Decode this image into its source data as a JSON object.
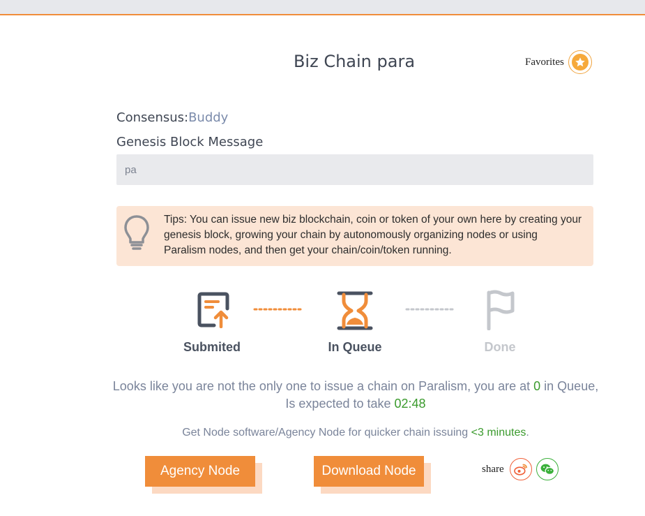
{
  "header": {
    "title": "Biz Chain para"
  },
  "favorites": {
    "label": "Favorites",
    "icon": "star-icon"
  },
  "consensus": {
    "label": "Consensus:",
    "value": "Buddy"
  },
  "genesis": {
    "label": "Genesis Block Message",
    "value": "pa"
  },
  "tips": {
    "icon": "lightbulb-icon",
    "text": "Tips: You can issue new biz blockchain, coin or token of your own here by creating your genesis block, growing your chain by autonomously organizing nodes or using Paralism nodes, and then get your chain/coin/token running."
  },
  "steps": [
    {
      "label": "Submited",
      "icon": "document-upload-icon",
      "state": "done"
    },
    {
      "label": "In Queue",
      "icon": "hourglass-icon",
      "state": "active"
    },
    {
      "label": "Done",
      "icon": "flag-icon",
      "state": "pending"
    }
  ],
  "queue": {
    "part1": "Looks like you are not the only one to issue a chain on Paralism, you are at ",
    "position": "0",
    "part2": " in Queue, Is expected to take ",
    "time": "02:48"
  },
  "node_hint": {
    "text": "Get Node software/Agency Node for quicker chain issuing ",
    "highlight": "<3 minutes",
    "suffix": "."
  },
  "buttons": {
    "agency": "Agency Node",
    "download": "Download Node"
  },
  "share": {
    "label": "share",
    "icons": [
      "weibo-icon",
      "wechat-icon"
    ]
  },
  "colors": {
    "accent": "#f08d3a",
    "green": "#3a9a2c",
    "muted": "#c4c7cc",
    "dark": "#4a5260"
  }
}
